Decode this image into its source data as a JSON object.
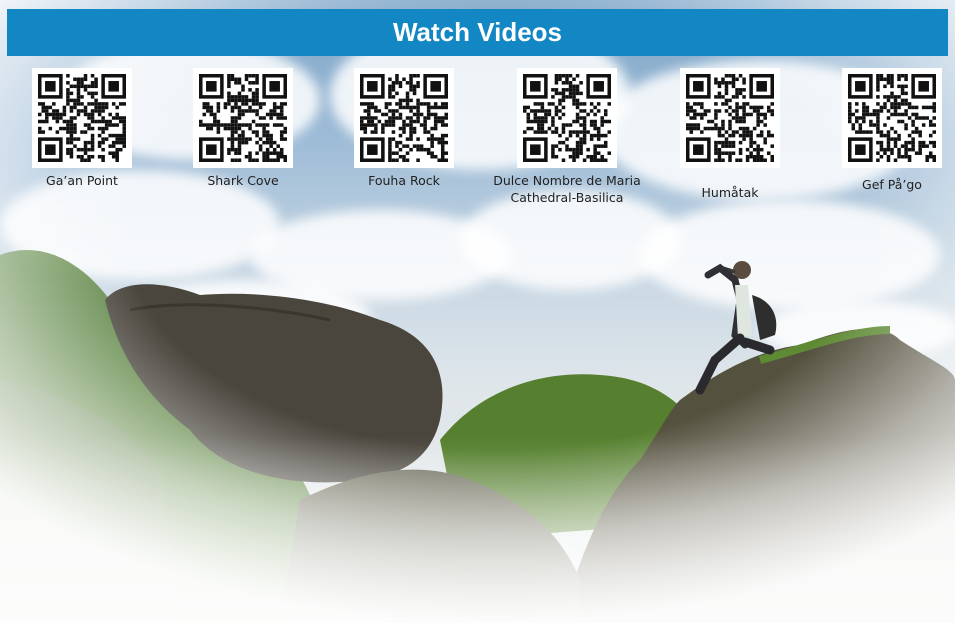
{
  "banner": {
    "title": "Watch Videos",
    "bg_color": "#1287c4"
  },
  "videos": [
    {
      "label": "Ga’an Point",
      "icon": "qr-code"
    },
    {
      "label": "Shark Cove",
      "icon": "qr-code"
    },
    {
      "label": "Fouha Rock",
      "icon": "qr-code"
    },
    {
      "label": "Dulce Nombre de Maria\nCathedral-Basilica",
      "icon": "qr-code"
    },
    {
      "label": "Humåtak",
      "icon": "qr-code"
    },
    {
      "label": "Gef På’go",
      "icon": "qr-code"
    }
  ],
  "background_photo": {
    "description": "hiker on rocky ridge under cloudy sky",
    "colors": {
      "sky": "#9dbbd6",
      "rock": "#4a463e",
      "vegetation": "#4f7a2f"
    }
  }
}
